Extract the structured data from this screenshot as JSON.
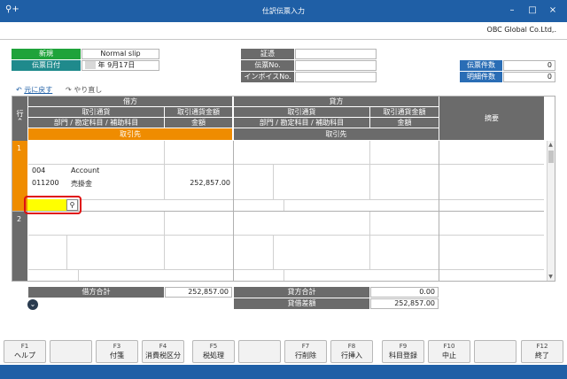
{
  "window": {
    "title": "仕訳伝票入力",
    "app_icon": "search-plus-icon",
    "minimize": "–",
    "maximize": "□",
    "close": "×",
    "company": "OBC Global Co.Ltd,."
  },
  "header": {
    "slip_type_label": "新規",
    "slip_type_value": "Normal slip",
    "date_label": "伝票日付",
    "date_value": "年  9月17日",
    "voucher_label": "証憑",
    "voucher_value": "",
    "slip_no_label": "伝票No.",
    "slip_no_value": "",
    "invoice_no_label": "インボイスNo.",
    "invoice_no_value": "",
    "slip_count_label": "伝票件数",
    "slip_count_value": "0",
    "detail_count_label": "明細件数",
    "detail_count_value": "0"
  },
  "history": {
    "undo": "元に戻す",
    "redo": "やり直し"
  },
  "grid": {
    "row_header": "行",
    "debit": "借方",
    "credit": "貸方",
    "currency": "取引通貨",
    "currency_amount": "取引通貨金額",
    "account": "部門 / 勘定科目 / 補助科目",
    "amount": "金額",
    "partner": "取引先",
    "summary": "摘要",
    "row1_no": "1",
    "row2_no": "2",
    "row1": {
      "dept_code": "004",
      "dept_name": "Account",
      "account_code": "011200",
      "account_name": "売掛金",
      "amount": "252,857.00"
    }
  },
  "totals": {
    "debit_total_label": "借方合計",
    "debit_total_value": "252,857.00",
    "credit_total_label": "貸方合計",
    "credit_total_value": "0.00",
    "diff_label": "貸借差額",
    "diff_value": "252,857.00"
  },
  "fkeys": [
    {
      "fn": "F1",
      "label": "ヘルプ"
    },
    {
      "fn": "",
      "label": ""
    },
    {
      "fn": "F3",
      "label": "付箋"
    },
    {
      "fn": "F4",
      "label": "消費税区分"
    },
    {
      "fn": "F5",
      "label": "税処理"
    },
    {
      "fn": "",
      "label": ""
    },
    {
      "fn": "F7",
      "label": "行削除"
    },
    {
      "fn": "F8",
      "label": "行挿入"
    },
    {
      "fn": "F9",
      "label": "科目登録"
    },
    {
      "fn": "F10",
      "label": "中止"
    },
    {
      "fn": "",
      "label": ""
    },
    {
      "fn": "F12",
      "label": "終了"
    }
  ],
  "colors": {
    "titlebar": "#1f5fa6",
    "orange": "#ef8c00",
    "highlight": "#ffff00",
    "red_outline": "#e01010"
  }
}
